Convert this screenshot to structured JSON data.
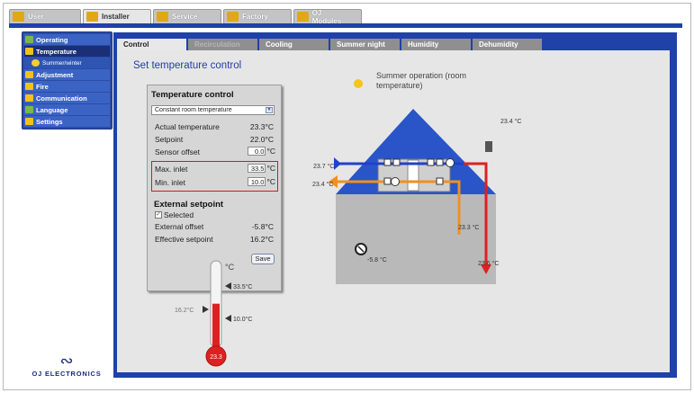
{
  "top_tabs": [
    {
      "label": "User",
      "icon": "users-icon",
      "color": "#e0a817"
    },
    {
      "label": "Installer",
      "icon": "installer-icon",
      "color": "#e0a817"
    },
    {
      "label": "Service",
      "icon": "service-icon",
      "color": "#e0a817"
    },
    {
      "label": "Factory",
      "icon": "factory-icon",
      "color": "#e0a817"
    },
    {
      "label": "OJ Modules",
      "icon": "modules-icon",
      "color": "#e0a817"
    }
  ],
  "sidebar": {
    "items": [
      {
        "label": "Operating",
        "icon": "operating-icon"
      },
      {
        "label": "Temperature",
        "icon": "thermometer-icon"
      },
      {
        "label": "Summer/winter",
        "icon": "sun-icon"
      },
      {
        "label": "Adjustment",
        "icon": "adjustment-icon"
      },
      {
        "label": "Fire",
        "icon": "fire-icon"
      },
      {
        "label": "Communication",
        "icon": "communication-icon"
      },
      {
        "label": "Language",
        "icon": "language-icon"
      },
      {
        "label": "Settings",
        "icon": "settings-icon"
      }
    ]
  },
  "logo": {
    "mark": "∾",
    "text": "OJ ELECTRONICS"
  },
  "sub_tabs": [
    "Control",
    "Recirculation",
    "Cooling",
    "Summer night",
    "Humidity",
    "Dehumidity"
  ],
  "page_title": "Set temperature control",
  "panel": {
    "title": "Temperature control",
    "mode_select": "Constant room temperature",
    "actual_temperature": {
      "label": "Actual temperature",
      "value": "23.3°C"
    },
    "setpoint": {
      "label": "Setpoint",
      "value": "22.0°C"
    },
    "sensor_offset": {
      "label": "Sensor offset",
      "value": "0.0",
      "unit": "°C"
    },
    "max_inlet": {
      "label": "Max. inlet",
      "value": "33.5",
      "unit": "°C"
    },
    "min_inlet": {
      "label": "Min. inlet",
      "value": "10.0",
      "unit": "°C"
    },
    "external_title": "External setpoint",
    "selected_label": "Selected",
    "external_offset": {
      "label": "External offset",
      "value": "-5.8°C"
    },
    "effective_setpoint": {
      "label": "Effective setpoint",
      "value": "16.2°C"
    },
    "save_label": "Save"
  },
  "thermometer": {
    "unit": "°C",
    "max_marker": "33.5°C",
    "setpoint_marker": "16.2°C",
    "min_marker": "10.0°C",
    "bulb_value": "23.3",
    "fill_fraction": 0.55
  },
  "diagram": {
    "season_label": "Summer operation (room temperature)",
    "outdoor_temp": "23.4 °C",
    "intake_temp": "23.7 °C",
    "exhaust_temp": "23.4 °C",
    "extract_temp": "23.3 °C",
    "supply_temp": "23.6 °C",
    "room_sensor_temp": "-5.8 °C",
    "colors": {
      "roof": "#2a55c8",
      "wall": "#b9b9b9",
      "supply": "#e02020",
      "extract": "#f09020",
      "intake": "#2040d0"
    }
  }
}
